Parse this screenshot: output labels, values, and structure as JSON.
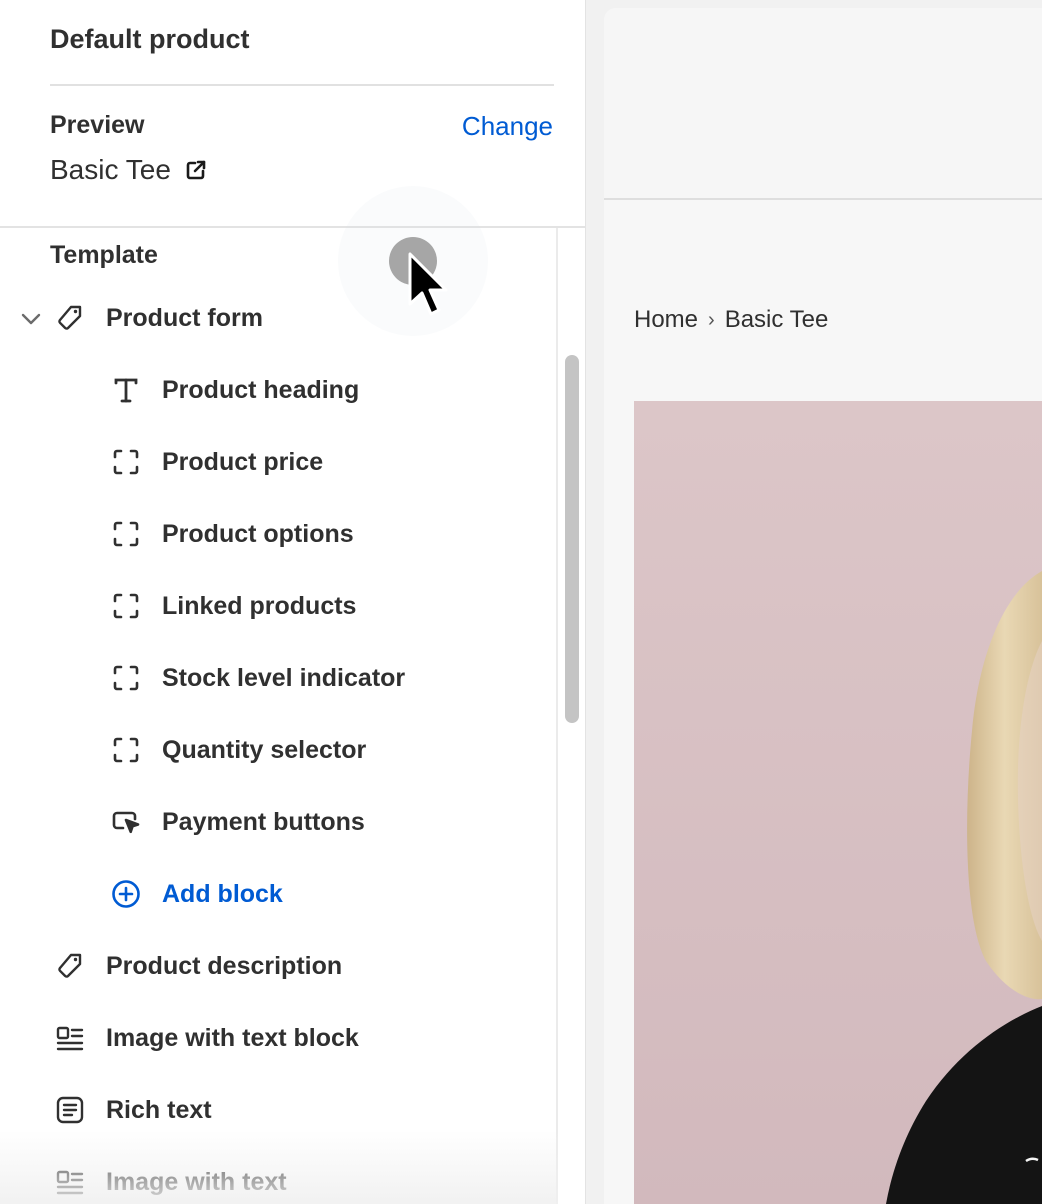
{
  "sidebar": {
    "title": "Default product",
    "preview": {
      "label": "Preview",
      "change": "Change",
      "value": "Basic Tee",
      "external_icon": "external-link-icon"
    },
    "template": {
      "label": "Template",
      "sections": [
        {
          "label": "Product form",
          "icon": "tag-icon",
          "expanded": true,
          "blocks": [
            {
              "label": "Product heading",
              "icon": "text-icon"
            },
            {
              "label": "Product price",
              "icon": "block-icon"
            },
            {
              "label": "Product options",
              "icon": "block-icon"
            },
            {
              "label": "Linked products",
              "icon": "block-icon"
            },
            {
              "label": "Stock level indicator",
              "icon": "block-icon"
            },
            {
              "label": "Quantity selector",
              "icon": "block-icon"
            },
            {
              "label": "Payment buttons",
              "icon": "pointer-icon"
            }
          ],
          "add_block": {
            "label": "Add block",
            "icon": "plus-circle-icon"
          }
        },
        {
          "label": "Product description",
          "icon": "tag-icon"
        },
        {
          "label": "Image with text block",
          "icon": "image-text-icon"
        },
        {
          "label": "Rich text",
          "icon": "rich-text-icon"
        },
        {
          "label": "Image with text",
          "icon": "image-text-icon"
        }
      ]
    }
  },
  "preview_pane": {
    "breadcrumb": {
      "home": "Home",
      "separator": "›",
      "current": "Basic Tee"
    }
  },
  "colors": {
    "accent": "#005bd3",
    "text": "#303030",
    "image_background": "#d9c3c6",
    "shirt": "#141414"
  }
}
